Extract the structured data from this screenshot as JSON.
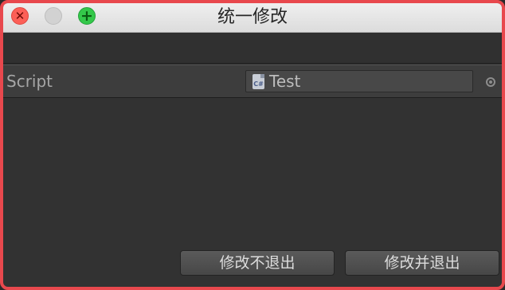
{
  "window": {
    "title": "统一修改"
  },
  "titlebar": {
    "close_glyph": "✕",
    "zoom_glyph": "+"
  },
  "inspector": {
    "script_label": "Script",
    "script_value": "Test",
    "script_icon": "C#"
  },
  "buttons": {
    "modify_no_exit": "修改不退出",
    "modify_and_exit": "修改并退出"
  }
}
